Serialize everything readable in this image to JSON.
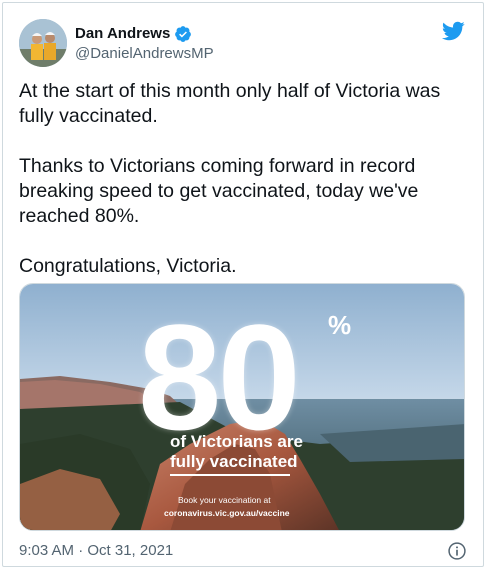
{
  "author": {
    "display_name": "Dan Andrews",
    "handle": "@DanielAndrewsMP",
    "verified": true,
    "avatar_icon": "avatar-photo"
  },
  "tweet": {
    "paragraphs": [
      "At the start of this month only half of Victoria was fully vaccinated.",
      "Thanks to Victorians coming forward in record breaking speed to get vaccinated, today we've reached 80%.",
      "Congratulations, Victoria."
    ]
  },
  "media": {
    "big_number": "80",
    "percent_sign": "%",
    "caption_line1": "of Victorians are",
    "caption_line2": "fully vaccinated",
    "cta_line1": "Book your vaccination at",
    "cta_line2": "coronavirus.vic.gov.au/vaccine"
  },
  "footer": {
    "timestamp": "9:03 AM · Oct 31, 2021"
  },
  "colors": {
    "twitter_blue": "#1d9bf0",
    "text_secondary": "#536471"
  },
  "icons": [
    "twitter-bird-icon",
    "verified-badge-icon",
    "info-icon"
  ]
}
